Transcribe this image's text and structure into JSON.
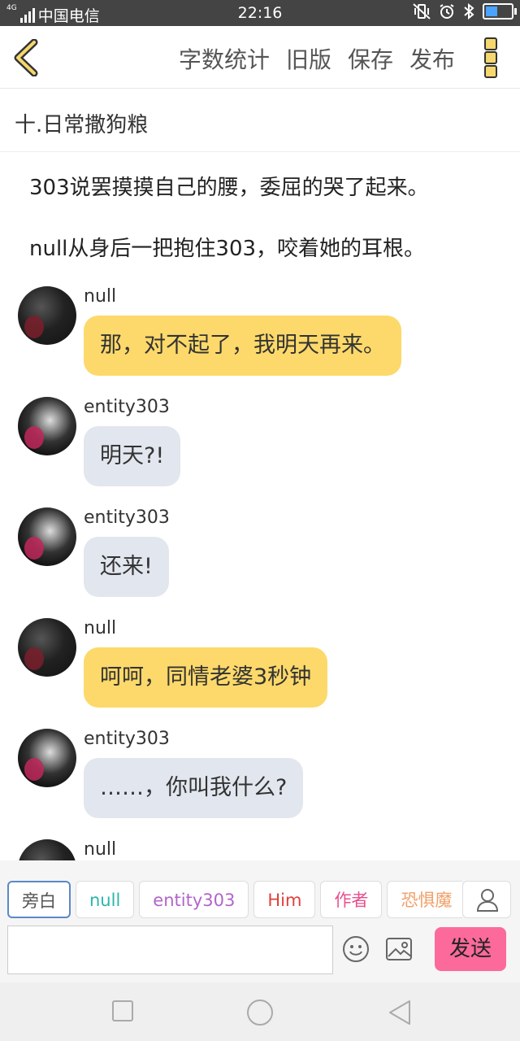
{
  "status_bar": {
    "carrier": "中国电信",
    "network": "4G",
    "time": "22:16"
  },
  "header": {
    "actions": [
      "字数统计",
      "旧版",
      "保存",
      "发布"
    ]
  },
  "chapter_title": "十.日常撒狗粮",
  "narration": [
    "303说罢摸摸自己的腰，委屈的哭了起来。",
    "null从身后一把抱住303，咬着她的耳根。"
  ],
  "messages": [
    {
      "sender": "null",
      "text": "那，对不起了，我明天再来。",
      "style": "yellow",
      "avatar": "null-avatar"
    },
    {
      "sender": "entity303",
      "text": "明天?!",
      "style": "gray",
      "avatar": "entity303-avatar"
    },
    {
      "sender": "entity303",
      "text": "还来!",
      "style": "gray",
      "avatar": "entity303-avatar"
    },
    {
      "sender": "null",
      "text": "呵呵，同情老婆3秒钟",
      "style": "yellow",
      "avatar": "null-avatar"
    },
    {
      "sender": "entity303",
      "text": "……，你叫我什么?",
      "style": "gray",
      "avatar": "entity303-avatar"
    },
    {
      "sender": "null",
      "text": "",
      "style": "yellow",
      "avatar": "null-avatar"
    }
  ],
  "roles": [
    {
      "label": "旁白",
      "color": "#555555"
    },
    {
      "label": "null",
      "color": "#2bb5a8"
    },
    {
      "label": "entity303",
      "color": "#b265c9"
    },
    {
      "label": "Him",
      "color": "#e0413a"
    },
    {
      "label": "作者",
      "color": "#e8508f"
    },
    {
      "label": "恐惧魔",
      "color": "#f0a06a"
    }
  ],
  "composer": {
    "input_value": "",
    "send_label": "发送"
  },
  "colors": {
    "accent_yellow": "#fcd96a",
    "bubble_gray": "#e2e6ee",
    "send_pink": "#fb6a9b",
    "active_chip_border": "#5b88c8"
  }
}
